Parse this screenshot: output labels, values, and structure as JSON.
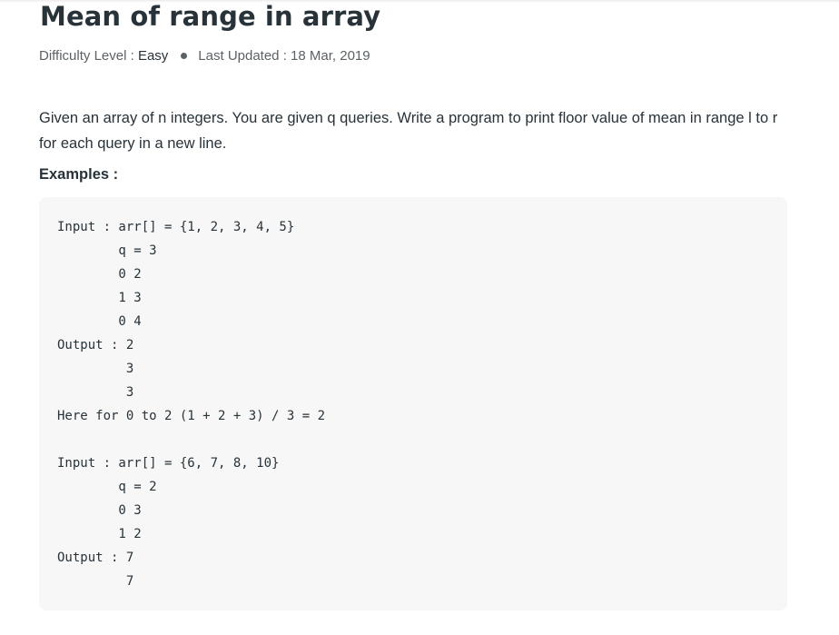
{
  "article": {
    "title": "Mean of range in array",
    "meta": {
      "difficulty_label": "Difficulty Level : ",
      "difficulty_value": "Easy",
      "updated_label": "Last Updated : ",
      "updated_value": "18 Mar, 2019"
    },
    "intro": "Given an array of n integers. You are given q queries. Write a program to print floor value of mean in range l to r for each query in a new line.",
    "examples_heading": "Examples :",
    "code_lines": [
      "Input : arr[] = {1, 2, 3, 4, 5}",
      "        q = 3",
      "        0 2",
      "        1 3",
      "        0 4",
      "Output : 2",
      "         3",
      "         3",
      "Here for 0 to 2 (1 + 2 + 3) / 3 = 2",
      "",
      "Input : arr[] = {6, 7, 8, 10}",
      "        q = 2",
      "        0 3",
      "        1 2",
      "Output : 7",
      "         7"
    ]
  }
}
